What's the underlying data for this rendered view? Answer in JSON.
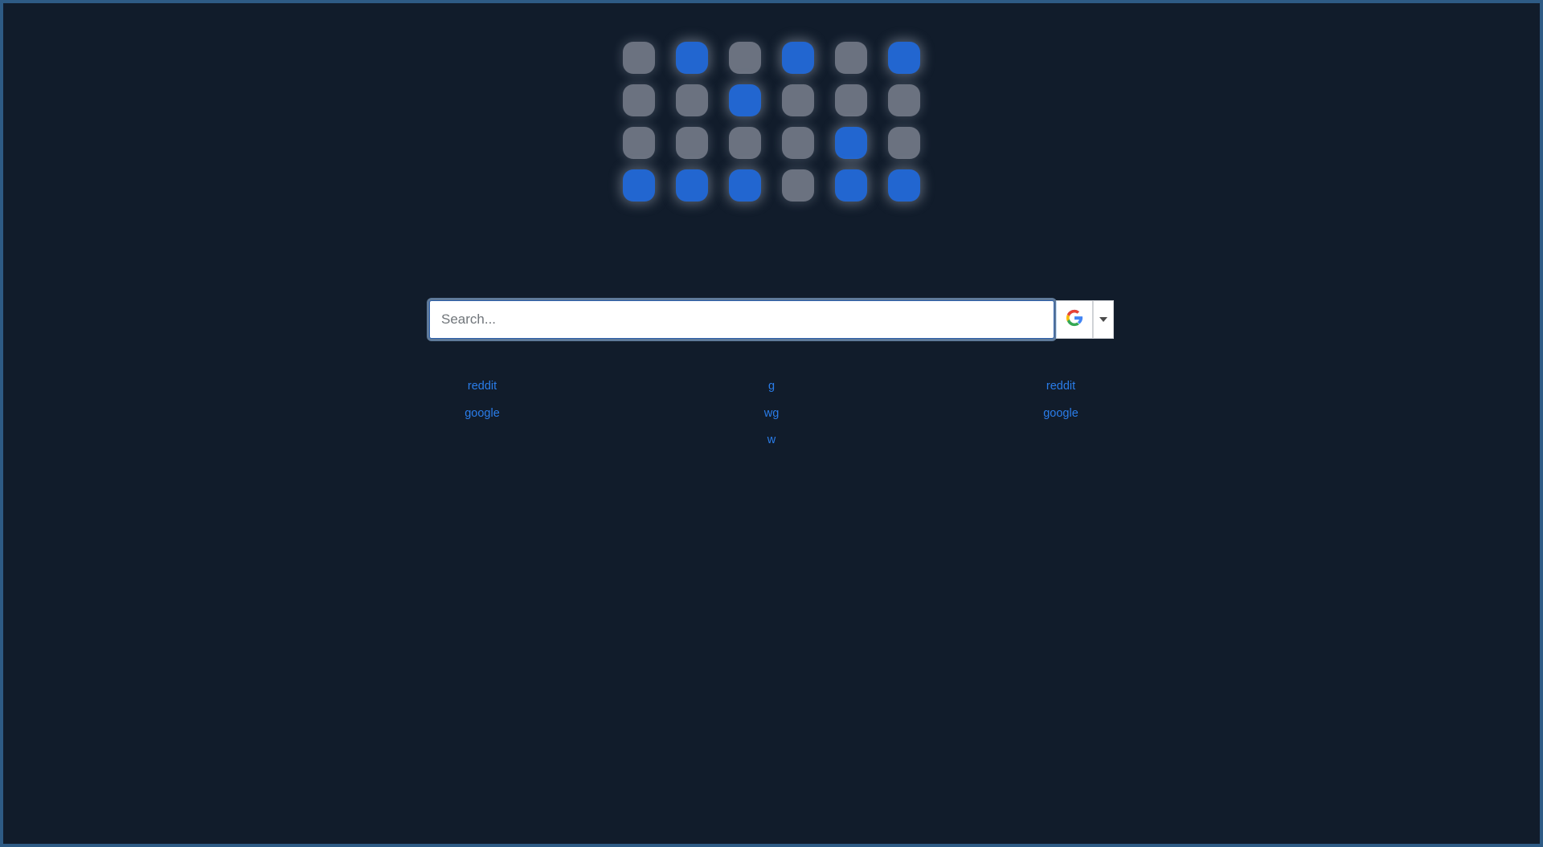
{
  "theme": {
    "page_background": "#111c2b",
    "border_color": "#2e5b85",
    "tile_gray": "#6b7280",
    "tile_blue": "#2266d0",
    "link_color": "#2a7dea"
  },
  "logo": {
    "name": "app-grid-logo",
    "columns": 6,
    "rows": 4,
    "tiles": [
      [
        "gray",
        "blue",
        "gray",
        "blue",
        "gray",
        "blue"
      ],
      [
        "gray",
        "gray",
        "blue",
        "gray",
        "gray",
        "gray"
      ],
      [
        "gray",
        "gray",
        "gray",
        "gray",
        "blue",
        "gray"
      ],
      [
        "blue",
        "blue",
        "blue",
        "gray",
        "blue",
        "blue"
      ]
    ]
  },
  "search": {
    "placeholder": "Search...",
    "value": "",
    "engine_icon": "google-logo-icon",
    "engine_name": "Google",
    "dropdown_icon": "chevron-down-icon"
  },
  "links": {
    "columns": [
      {
        "name": "left",
        "items": [
          {
            "label": "reddit"
          },
          {
            "label": "google"
          }
        ]
      },
      {
        "name": "center",
        "items": [
          {
            "label": "g"
          },
          {
            "label": "wg"
          },
          {
            "label": "w"
          }
        ]
      },
      {
        "name": "right",
        "items": [
          {
            "label": "reddit"
          },
          {
            "label": "google"
          }
        ]
      }
    ]
  }
}
